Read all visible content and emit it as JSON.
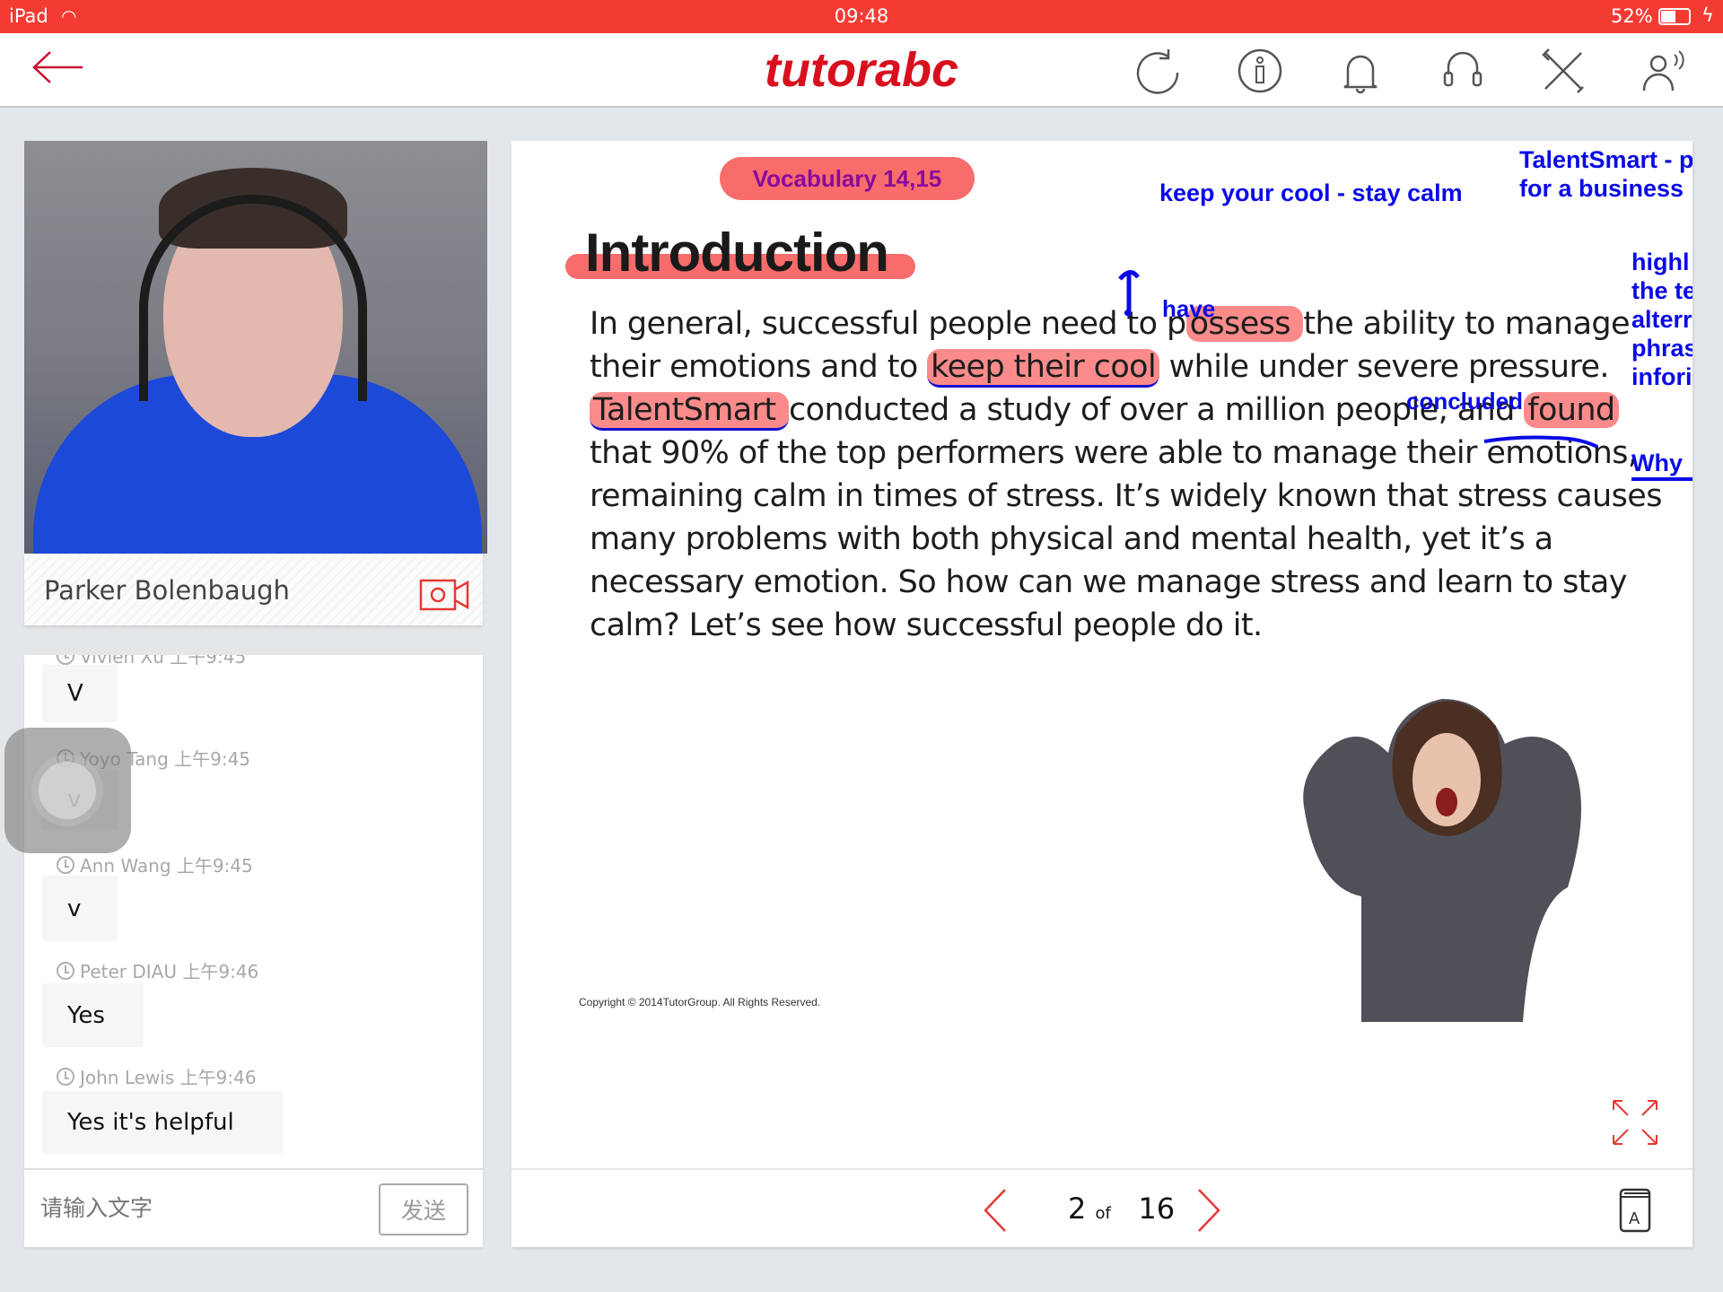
{
  "status_bar": {
    "device": "iPad",
    "time": "09:48",
    "battery": "52%"
  },
  "header": {
    "logo": "tutorabc",
    "icons": [
      "refresh-icon",
      "info-icon",
      "bell-icon",
      "headset-icon",
      "tools-icon",
      "users-audio-icon"
    ]
  },
  "colors": {
    "brand_red": "#d8101e",
    "status_red": "#f43b33",
    "annotation_blue": "#0a0ae6",
    "highlight": "#fa5a5a"
  },
  "teacher": {
    "name": "Parker Bolenbaugh"
  },
  "chat": {
    "messages": [
      {
        "sender": "Vivien Xu 上午9:45",
        "text": "V"
      },
      {
        "sender": "Yoyo Tang 上午9:45",
        "text": "v"
      },
      {
        "sender": "Ann Wang 上午9:45",
        "text": "v"
      },
      {
        "sender": "Peter DIAU 上午9:46",
        "text": "Yes"
      },
      {
        "sender": "John Lewis 上午9:46",
        "text": "Yes it's helpful"
      }
    ],
    "input_placeholder": "请输入文字",
    "send_label": "发送"
  },
  "slide": {
    "vocab_label": "Vocabulary 14,15",
    "title": "Introduction",
    "lines": [
      [
        "In general, successful people need to p",
        "ossess ",
        "the ability to manage"
      ],
      [
        "their emotions and to ",
        "keep their cool",
        " while under severe pressure."
      ],
      [
        "TalentSmart ",
        "conducted a study of over a million people, and ",
        "found"
      ],
      [
        "that 90% of the top performers were able to manage their emotions,"
      ],
      [
        "remaining calm in times of stress. It’s widely known that stress causes"
      ],
      [
        "many problems with both physical and mental health, yet it’s a"
      ],
      [
        "necessary emotion. So how can we manage stress and learn to stay"
      ],
      [
        "calm? Let’s see how successful people do it."
      ]
    ],
    "annotations": {
      "have": "have",
      "concluded": "concluded",
      "keep_cool": "keep your cool - stay calm",
      "talentsmart_1": "TalentSmart - p",
      "talentsmart_2": "for a business",
      "side": [
        "highl",
        "the te",
        "alterr",
        "phras",
        "infori"
      ],
      "why": "Why"
    },
    "copyright": "Copyright © 2014TutorGroup. All Rights Reserved."
  },
  "pager": {
    "current": "2",
    "of": "of",
    "total": "16"
  }
}
